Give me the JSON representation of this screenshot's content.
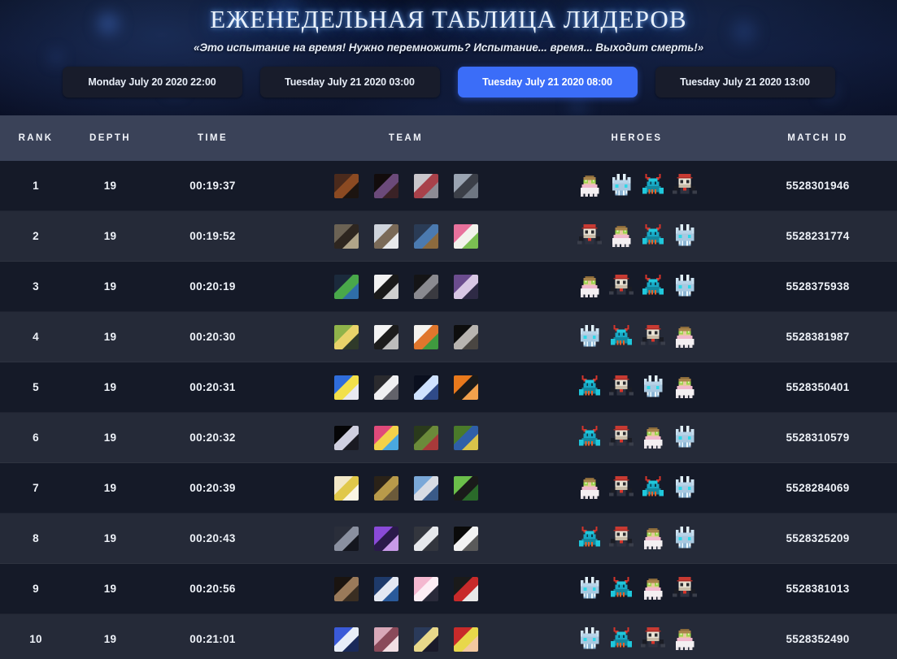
{
  "header": {
    "title": "ЕЖЕНЕДЕЛЬНАЯ ТАБЛИЦА ЛИДЕРОВ",
    "subtitle": "«Это испытание на время! Нужно перемножить? Испытание... время... Выходит смерть!»"
  },
  "tabs": [
    {
      "label": "Monday July 20 2020 22:00",
      "active": false
    },
    {
      "label": "Tuesday July 21 2020 03:00",
      "active": false
    },
    {
      "label": "Tuesday July 21 2020 08:00",
      "active": true
    },
    {
      "label": "Tuesday July 21 2020 13:00",
      "active": false
    }
  ],
  "colors": {
    "accent": "#3b6df8",
    "header_bar": "#3a4258",
    "row_odd": "#151a28",
    "row_even": "#252a38",
    "text": "#eef2f8"
  },
  "table": {
    "columns": [
      "RANK",
      "DEPTH",
      "TIME",
      "TEAM",
      "HEROES",
      "MATCH ID"
    ],
    "rows": [
      {
        "rank": "1",
        "depth": "19",
        "time": "00:19:37",
        "match_id": "5528301946",
        "team": [
          {
            "name": "avatar-orange-creature-dark-room",
            "c1": "#4a2a1c",
            "c2": "#8b4a22",
            "c3": "#1c1410"
          },
          {
            "name": "avatar-dark-closeup-purple-light",
            "c1": "#120c0c",
            "c2": "#6b4a7a",
            "c3": "#3a2226"
          },
          {
            "name": "avatar-person-red-coat-snow",
            "c1": "#c9c6cb",
            "c2": "#a8414a",
            "c3": "#8d8b94"
          },
          {
            "name": "avatar-silhouette-grey-sky",
            "c1": "#9aa4b2",
            "c2": "#3b3f48",
            "c3": "#6e7682"
          }
        ],
        "heroes": [
          "sage",
          "frost",
          "crab",
          "gunner"
        ]
      },
      {
        "rank": "2",
        "depth": "19",
        "time": "00:19:52",
        "match_id": "5528231774",
        "team": [
          {
            "name": "avatar-boar-animal-outdoors",
            "c1": "#6b6254",
            "c2": "#2e2620",
            "c3": "#b0a489"
          },
          {
            "name": "avatar-tabby-cat-face",
            "c1": "#cfd4dc",
            "c2": "#7a6a58",
            "c3": "#e8e9ec"
          },
          {
            "name": "avatar-blue-helmet-character",
            "c1": "#2a3b55",
            "c2": "#4b7ab0",
            "c3": "#8c6a3e"
          },
          {
            "name": "avatar-pink-frog-meme",
            "c1": "#e8719c",
            "c2": "#f2f2ec",
            "c3": "#7bbf52"
          }
        ],
        "heroes": [
          "gunner",
          "sage",
          "crab",
          "frost"
        ]
      },
      {
        "rank": "3",
        "depth": "19",
        "time": "00:20:19",
        "match_id": "5528375938",
        "team": [
          {
            "name": "avatar-pixel-landscape-green",
            "c1": "#1b2a3c",
            "c2": "#49a84a",
            "c3": "#2f6ea8"
          },
          {
            "name": "avatar-manga-boy-bw",
            "c1": "#f2f2f2",
            "c2": "#1a1a1a",
            "c3": "#cfcfcf"
          },
          {
            "name": "avatar-dark-abstract-figure",
            "c1": "#141416",
            "c2": "#8a8a90",
            "c3": "#3a3a40"
          },
          {
            "name": "avatar-anime-girl-purple-hair",
            "c1": "#6b4c8e",
            "c2": "#d8c7e4",
            "c3": "#2e2a45"
          }
        ],
        "heroes": [
          "sage",
          "gunner",
          "crab",
          "frost"
        ]
      },
      {
        "rank": "4",
        "depth": "19",
        "time": "00:20:30",
        "match_id": "5528381987",
        "team": [
          {
            "name": "avatar-person-yellow-outfit",
            "c1": "#8fb34a",
            "c2": "#e8d36a",
            "c3": "#2f3a2a"
          },
          {
            "name": "avatar-manga-sketch-bw",
            "c1": "#f4f4f4",
            "c2": "#1c1c1c",
            "c3": "#bcbcbc"
          },
          {
            "name": "avatar-cartoon-cat-logo-green",
            "c1": "#f5f3ef",
            "c2": "#e0762c",
            "c3": "#3f9a3f"
          },
          {
            "name": "avatar-portrait-bw-woman",
            "c1": "#0d0d0d",
            "c2": "#b8b4b0",
            "c3": "#4a4642"
          }
        ],
        "heroes": [
          "frost",
          "crab",
          "gunner",
          "sage"
        ]
      },
      {
        "rank": "5",
        "depth": "19",
        "time": "00:20:31",
        "match_id": "5528350401",
        "team": [
          {
            "name": "avatar-blue-text-meme",
            "c1": "#2f6ddb",
            "c2": "#f2e04a",
            "c3": "#e8e8f0"
          },
          {
            "name": "avatar-white-sketch-dark",
            "c1": "#2a2a2e",
            "c2": "#f0f0f2",
            "c3": "#62626a"
          },
          {
            "name": "avatar-space-comet",
            "c1": "#0a0f1e",
            "c2": "#cfe2ff",
            "c3": "#2f4a88"
          },
          {
            "name": "avatar-orange-sunglasses",
            "c1": "#e8791c",
            "c2": "#1a1a1a",
            "c3": "#f2a14c"
          }
        ],
        "heroes": [
          "crab",
          "gunner",
          "frost",
          "sage"
        ]
      },
      {
        "rank": "6",
        "depth": "19",
        "time": "00:20:32",
        "match_id": "5528310579",
        "team": [
          {
            "name": "avatar-black-starfield",
            "c1": "#050507",
            "c2": "#cfcfdf",
            "c3": "#1a1a22"
          },
          {
            "name": "avatar-colorful-skull-art",
            "c1": "#e04a7a",
            "c2": "#f2d24a",
            "c3": "#4aa8e0"
          },
          {
            "name": "avatar-green-character-hat",
            "c1": "#2a3a1c",
            "c2": "#6b8a3a",
            "c3": "#a83a3a"
          },
          {
            "name": "avatar-green-field-character",
            "c1": "#4a7a2a",
            "c2": "#2f5fa8",
            "c3": "#d8c24a"
          }
        ],
        "heroes": [
          "crab",
          "gunner",
          "sage",
          "frost"
        ]
      },
      {
        "rank": "7",
        "depth": "19",
        "time": "00:20:39",
        "match_id": "5528284069",
        "team": [
          {
            "name": "avatar-banana-peeled",
            "c1": "#f2e8c8",
            "c2": "#e0c84a",
            "c3": "#fbf6e4"
          },
          {
            "name": "avatar-hooded-figure-framed",
            "c1": "#2a2218",
            "c2": "#b89a4a",
            "c3": "#6b5a3a"
          },
          {
            "name": "avatar-city-photo-blue",
            "c1": "#7aa8d8",
            "c2": "#d8dce4",
            "c3": "#3a5a88"
          },
          {
            "name": "avatar-green-pepe-meme",
            "c1": "#6bbf4a",
            "c2": "#1a1a1a",
            "c3": "#2a6a2a"
          }
        ],
        "heroes": [
          "sage",
          "gunner",
          "crab",
          "frost"
        ]
      },
      {
        "rank": "8",
        "depth": "19",
        "time": "00:20:43",
        "match_id": "5528325209",
        "team": [
          {
            "name": "avatar-dark-hooded-person",
            "c1": "#2a2e3a",
            "c2": "#8a90a0",
            "c3": "#14161e"
          },
          {
            "name": "avatar-purple-night-sky",
            "c1": "#8a4ad8",
            "c2": "#2a1a4a",
            "c3": "#c89ae8"
          },
          {
            "name": "avatar-question-mark-default",
            "c1": "#33363e",
            "c2": "#e6e8ec",
            "c3": "#33363e"
          },
          {
            "name": "avatar-skull-logo-black",
            "c1": "#0a0a0a",
            "c2": "#f2f2f2",
            "c3": "#5a5a5a"
          }
        ],
        "heroes": [
          "crab",
          "gunner",
          "sage",
          "frost"
        ]
      },
      {
        "rank": "9",
        "depth": "19",
        "time": "00:20:56",
        "match_id": "5528381013",
        "team": [
          {
            "name": "avatar-dark-photo-person",
            "c1": "#1a1410",
            "c2": "#9a7a5a",
            "c3": "#3a2e22"
          },
          {
            "name": "avatar-anime-blue-scene",
            "c1": "#1e3a6a",
            "c2": "#e4e8f2",
            "c3": "#2a5a9a"
          },
          {
            "name": "avatar-kirby-pink",
            "c1": "#f4b8d0",
            "c2": "#fdeef5",
            "c3": "#2a2a3a"
          },
          {
            "name": "avatar-anime-red-black",
            "c1": "#1a1a1a",
            "c2": "#c82a2a",
            "c3": "#e8e8e8"
          }
        ],
        "heroes": [
          "frost",
          "crab",
          "sage",
          "gunner"
        ]
      },
      {
        "rank": "10",
        "depth": "19",
        "time": "00:21:01",
        "match_id": "5528352490",
        "team": [
          {
            "name": "avatar-anime-blue-hair-girl",
            "c1": "#3a5ad8",
            "c2": "#e8eef8",
            "c3": "#1a2a5a"
          },
          {
            "name": "avatar-anime-pink-pair",
            "c1": "#d8a8b8",
            "c2": "#8a4a5a",
            "c3": "#f2dfe4"
          },
          {
            "name": "avatar-anime-blond-suit",
            "c1": "#2a3a5a",
            "c2": "#e8d88a",
            "c3": "#1a1a2a"
          },
          {
            "name": "avatar-red-yellow-cartoon",
            "c1": "#c82a2a",
            "c2": "#e8d84a",
            "c3": "#f2c8a0"
          }
        ],
        "heroes": [
          "frost",
          "crab",
          "gunner",
          "sage"
        ]
      }
    ]
  }
}
